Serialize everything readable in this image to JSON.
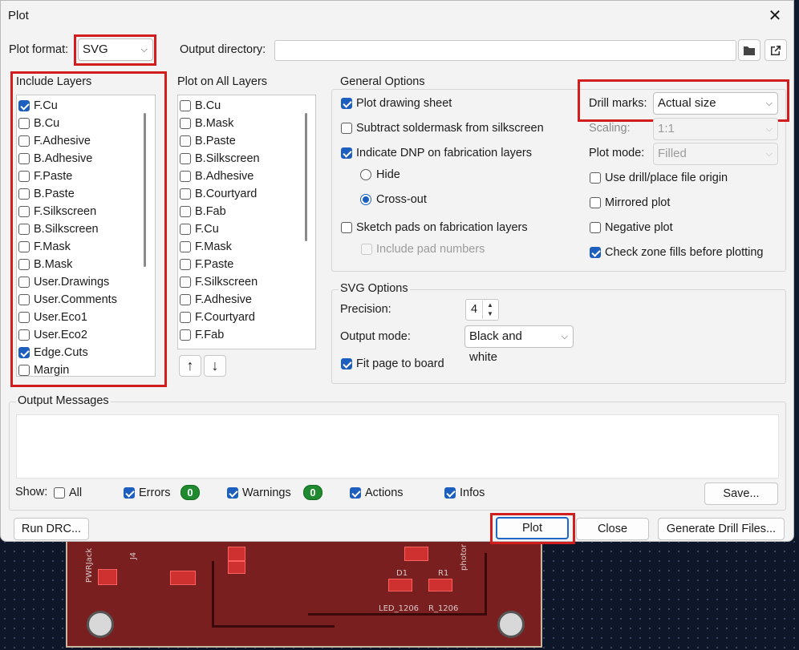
{
  "dialog": {
    "title": "Plot",
    "close_glyph": "✕"
  },
  "top": {
    "plot_format_label": "Plot format:",
    "plot_format_value": "SVG",
    "output_dir_label": "Output directory:",
    "output_dir_value": ""
  },
  "include_layers": {
    "title": "Include Layers",
    "items": [
      {
        "label": "F.Cu",
        "checked": true
      },
      {
        "label": "B.Cu",
        "checked": false
      },
      {
        "label": "F.Adhesive",
        "checked": false
      },
      {
        "label": "B.Adhesive",
        "checked": false
      },
      {
        "label": "F.Paste",
        "checked": false
      },
      {
        "label": "B.Paste",
        "checked": false
      },
      {
        "label": "F.Silkscreen",
        "checked": false
      },
      {
        "label": "B.Silkscreen",
        "checked": false
      },
      {
        "label": "F.Mask",
        "checked": false
      },
      {
        "label": "B.Mask",
        "checked": false
      },
      {
        "label": "User.Drawings",
        "checked": false
      },
      {
        "label": "User.Comments",
        "checked": false
      },
      {
        "label": "User.Eco1",
        "checked": false
      },
      {
        "label": "User.Eco2",
        "checked": false
      },
      {
        "label": "Edge.Cuts",
        "checked": true
      },
      {
        "label": "Margin",
        "checked": false
      }
    ]
  },
  "plot_all_layers": {
    "title": "Plot on All Layers",
    "items": [
      {
        "label": "B.Cu",
        "checked": false
      },
      {
        "label": "B.Mask",
        "checked": false
      },
      {
        "label": "B.Paste",
        "checked": false
      },
      {
        "label": "B.Silkscreen",
        "checked": false
      },
      {
        "label": "B.Adhesive",
        "checked": false
      },
      {
        "label": "B.Courtyard",
        "checked": false
      },
      {
        "label": "B.Fab",
        "checked": false
      },
      {
        "label": "F.Cu",
        "checked": false
      },
      {
        "label": "F.Mask",
        "checked": false
      },
      {
        "label": "F.Paste",
        "checked": false
      },
      {
        "label": "F.Silkscreen",
        "checked": false
      },
      {
        "label": "F.Adhesive",
        "checked": false
      },
      {
        "label": "F.Courtyard",
        "checked": false
      },
      {
        "label": "F.Fab",
        "checked": false
      }
    ],
    "up_glyph": "↑",
    "down_glyph": "↓"
  },
  "general_options": {
    "title": "General Options",
    "plot_drawing_sheet": {
      "label": "Plot drawing sheet",
      "checked": true
    },
    "subtract_soldermask": {
      "label": "Subtract soldermask from silkscreen",
      "checked": false
    },
    "indicate_dnp": {
      "label": "Indicate DNP on fabrication layers",
      "checked": true
    },
    "hide": {
      "label": "Hide",
      "selected": false
    },
    "cross_out": {
      "label": "Cross-out",
      "selected": true
    },
    "sketch_pads": {
      "label": "Sketch pads on fabrication layers",
      "checked": false
    },
    "include_pad_numbers": {
      "label": "Include pad numbers",
      "checked": false
    },
    "drill_marks_label": "Drill marks:",
    "drill_marks_value": "Actual size",
    "scaling_label": "Scaling:",
    "scaling_value": "1:1",
    "plot_mode_label": "Plot mode:",
    "plot_mode_value": "Filled",
    "use_drill_origin": {
      "label": "Use drill/place file origin",
      "checked": false
    },
    "mirrored_plot": {
      "label": "Mirrored plot",
      "checked": false
    },
    "negative_plot": {
      "label": "Negative plot",
      "checked": false
    },
    "check_zone_fills": {
      "label": "Check zone fills before plotting",
      "checked": true
    }
  },
  "svg_options": {
    "title": "SVG Options",
    "precision_label": "Precision:",
    "precision_value": "4",
    "output_mode_label": "Output mode:",
    "output_mode_value": "Black and white",
    "fit_page": {
      "label": "Fit page to board",
      "checked": true
    }
  },
  "output_messages": {
    "title": "Output Messages",
    "show_label": "Show:",
    "all": {
      "label": "All",
      "checked": false
    },
    "errors": {
      "label": "Errors",
      "checked": true,
      "count": "0"
    },
    "warnings": {
      "label": "Warnings",
      "checked": true,
      "count": "0"
    },
    "actions": {
      "label": "Actions",
      "checked": true
    },
    "infos": {
      "label": "Infos",
      "checked": true
    },
    "save_label": "Save..."
  },
  "buttons": {
    "run_drc": "Run DRC...",
    "plot": "Plot",
    "close": "Close",
    "generate_drill": "Generate Drill Files..."
  },
  "pcb_silk": {
    "d1": "D1",
    "r1": "R1",
    "led": "LED_1206",
    "res": "R_1206",
    "j4": "J4",
    "pwr": "PWRJack",
    "photo": "photor"
  },
  "colors": {
    "highlight": "#d11d1d",
    "accent": "#1d5fbf",
    "badge": "#1f8a2f"
  }
}
